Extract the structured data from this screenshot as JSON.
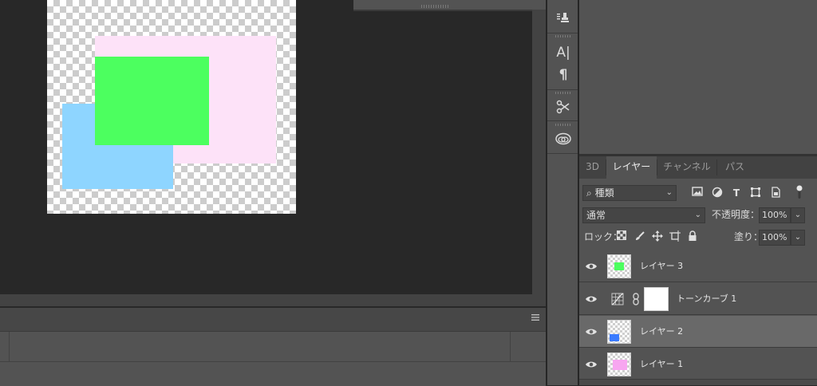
{
  "canvas": {
    "shapes": [
      {
        "name": "pink-rectangle",
        "color": "#fde2f8"
      },
      {
        "name": "blue-rectangle",
        "color": "#8ed5ff"
      },
      {
        "name": "green-rectangle",
        "color": "#4cff5f"
      }
    ]
  },
  "toolstrip": {
    "icons": [
      "clone-source-icon",
      "character-icon",
      "paragraph-icon",
      "tool-presets-icon",
      "libraries-icon"
    ],
    "character_label": "A|",
    "paragraph_label": "¶"
  },
  "layers_panel": {
    "tabs": [
      {
        "label": "3D",
        "active": false
      },
      {
        "label": "レイヤー",
        "active": true
      },
      {
        "label": "チャンネル",
        "active": false
      },
      {
        "label": "パス",
        "active": false
      }
    ],
    "filter": {
      "search_glyph": "⌕",
      "kind_label": "種類"
    },
    "blend_mode": "通常",
    "opacity_label": "不透明度：",
    "opacity_value": "100%",
    "lock_label": "ロック：",
    "fill_label": "塗り：",
    "fill_value": "100%",
    "layers": [
      {
        "name": "レイヤー 3",
        "visible": true,
        "thumb_color": "#4cff5f"
      },
      {
        "name": "トーンカーブ 1",
        "visible": true,
        "adjustment": true
      },
      {
        "name": "レイヤー 2",
        "visible": true,
        "selected": true,
        "thumb_color": "#3b7bff"
      },
      {
        "name": "レイヤー 1",
        "visible": true,
        "thumb_color": "#f7a6f0"
      }
    ]
  },
  "colors": {
    "ui_dark": "#282828",
    "panel": "#535353",
    "selected_row": "#696969"
  }
}
